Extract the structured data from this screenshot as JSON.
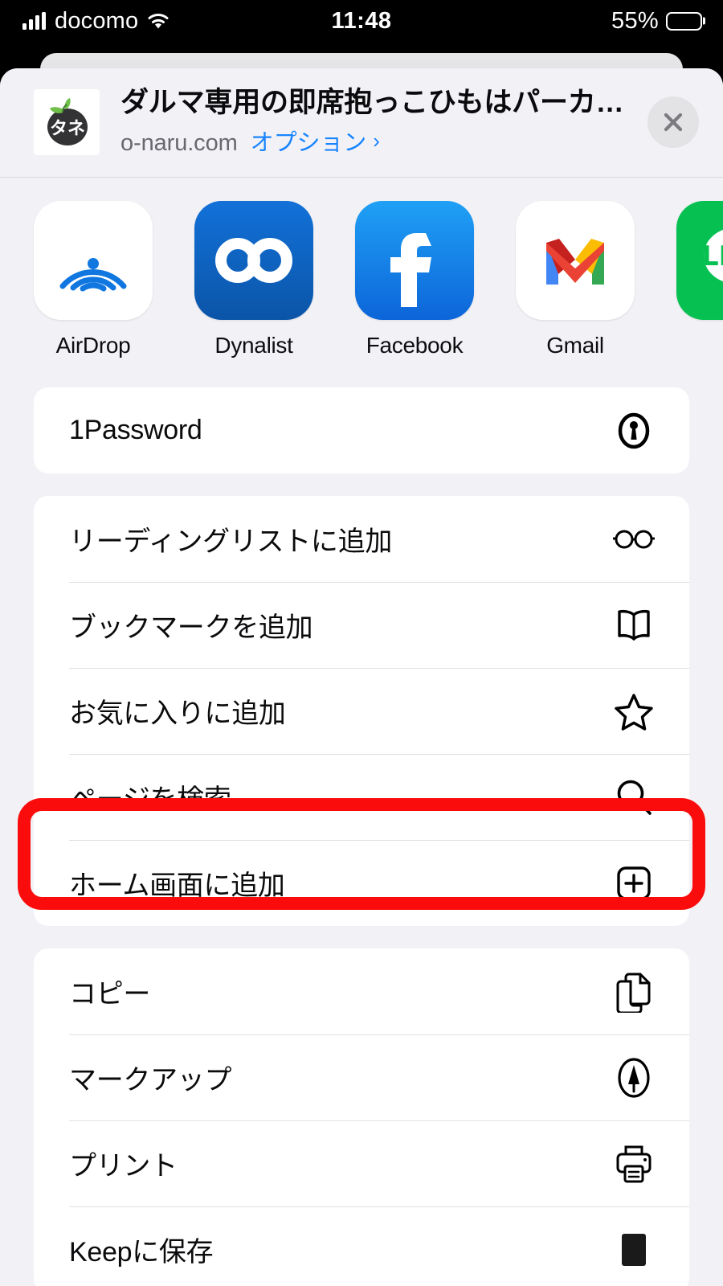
{
  "status_bar": {
    "carrier": "docomo",
    "time": "11:48",
    "battery_percent": "55%",
    "signal_icon": "cellular-bars-icon",
    "wifi_icon": "wifi-icon",
    "battery_icon": "battery-icon"
  },
  "share_header": {
    "title": "ダルマ専用の即席抱っこひもはパーカーで…",
    "domain": "o-naru.com",
    "options_label": "オプション",
    "options_chevron": "›",
    "favicon_text": "タネ",
    "close_icon": "close-icon"
  },
  "apps": [
    {
      "label": "AirDrop",
      "icon": "airdrop-icon"
    },
    {
      "label": "Dynalist",
      "icon": "dynalist-infinity-icon"
    },
    {
      "label": "Facebook",
      "icon": "facebook-f-icon"
    },
    {
      "label": "Gmail",
      "icon": "gmail-m-icon"
    },
    {
      "label": "",
      "icon": "line-icon"
    }
  ],
  "groups": [
    {
      "rows": [
        {
          "label": "1Password",
          "icon": "onepassword-keyhole-icon",
          "highlighted": false
        }
      ]
    },
    {
      "rows": [
        {
          "label": "リーディングリストに追加",
          "icon": "glasses-icon",
          "highlighted": false
        },
        {
          "label": "ブックマークを追加",
          "icon": "open-book-icon",
          "highlighted": false
        },
        {
          "label": "お気に入りに追加",
          "icon": "star-icon",
          "highlighted": false
        },
        {
          "label": "ページを検索",
          "icon": "search-icon",
          "highlighted": true
        },
        {
          "label": "ホーム画面に追加",
          "icon": "plus-square-icon",
          "highlighted": false
        }
      ]
    },
    {
      "rows": [
        {
          "label": "コピー",
          "icon": "copy-documents-icon",
          "highlighted": false
        },
        {
          "label": "マークアップ",
          "icon": "markup-pen-icon",
          "highlighted": false
        },
        {
          "label": "プリント",
          "icon": "printer-icon",
          "highlighted": false
        },
        {
          "label": "Keepに保存",
          "icon": "keep-icon",
          "highlighted": false
        }
      ]
    }
  ],
  "annotation": {
    "color": "#fa0c0c",
    "target_label": "ページを検索"
  }
}
